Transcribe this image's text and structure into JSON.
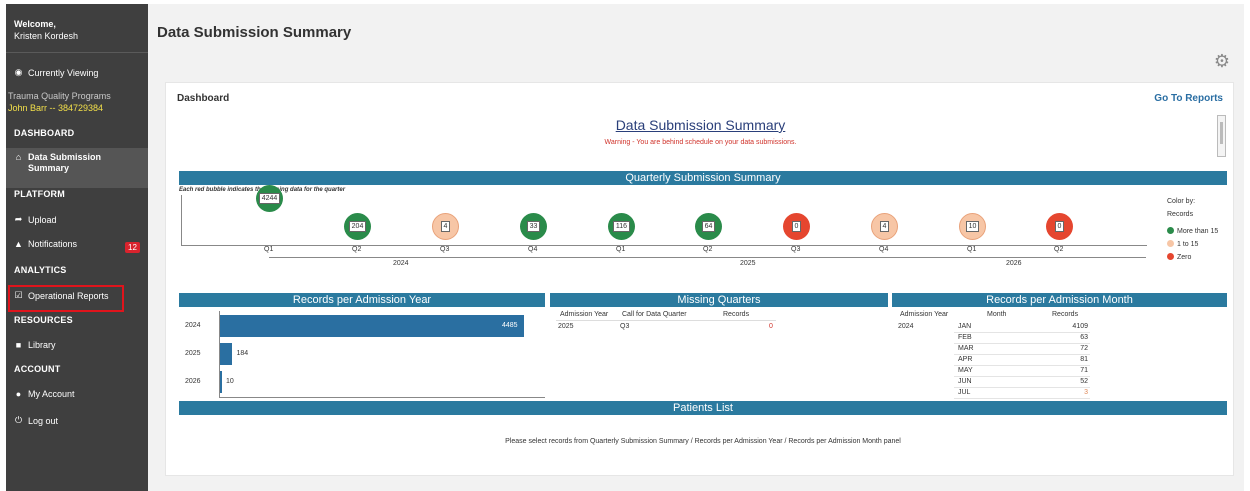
{
  "sidebar": {
    "welcome_title": "Welcome,",
    "user_name": "Kristen Kordesh",
    "currently_viewing": "Currently Viewing",
    "program_name": "Trauma Quality Programs",
    "program_user": "John Barr -- 384729384",
    "sections": {
      "dashboard": "DASHBOARD",
      "platform": "PLATFORM",
      "analytics": "ANALYTICS",
      "resources": "RESOURCES",
      "account": "ACCOUNT"
    },
    "items": {
      "data_submission_summary": "Data Submission Summary",
      "upload": "Upload",
      "notifications": "Notifications",
      "notifications_badge": "12",
      "operational_reports": "Operational Reports",
      "library": "Library",
      "my_account": "My Account",
      "log_out": "Log out"
    },
    "icons": {
      "eye": "eye-icon",
      "home": "home-icon",
      "upload": "upload-icon",
      "bell": "bell-icon",
      "report": "checkbox-report-icon",
      "book": "book-icon",
      "user": "user-icon",
      "power": "power-icon"
    }
  },
  "main": {
    "page_title": "Data Submission Summary",
    "dashboard_label": "Dashboard",
    "go_to_reports": "Go To Reports",
    "report_title": "Data Submission Summary",
    "warning": "Warning - You are behind schedule on your data submissions."
  },
  "quarterly": {
    "title": "Quarterly Submission Summary",
    "note": "Each red bubble indicates the missing data for the quarter",
    "bubbles": [
      {
        "label": "4244",
        "color": "green"
      },
      {
        "label": "204",
        "color": "green"
      },
      {
        "label": "4",
        "color": "orange"
      },
      {
        "label": "33",
        "color": "green"
      },
      {
        "label": "116",
        "color": "green"
      },
      {
        "label": "64",
        "color": "green"
      },
      {
        "label": "0",
        "color": "red"
      },
      {
        "label": "4",
        "color": "orange"
      },
      {
        "label": "10",
        "color": "orange"
      },
      {
        "label": "0",
        "color": "red"
      }
    ],
    "quarters": [
      "Q1",
      "Q2",
      "Q3",
      "Q4",
      "Q1",
      "Q2",
      "Q3",
      "Q4",
      "Q1",
      "Q2"
    ],
    "years": [
      "2024",
      "2025",
      "2026"
    ],
    "legend": {
      "title_line1": "Color by:",
      "title_line2": "Records",
      "items": [
        {
          "label": "More than 15",
          "color": "#2a8b4a"
        },
        {
          "label": "1 to 15",
          "color": "#f7c6a6"
        },
        {
          "label": "Zero",
          "color": "#e5462f"
        }
      ]
    }
  },
  "records_per_year": {
    "title": "Records per Admission Year"
  },
  "chart_data": {
    "type": "bar",
    "orientation": "horizontal",
    "title": "Records per Admission Year",
    "categories": [
      "2024",
      "2025",
      "2026"
    ],
    "values": [
      4485,
      184,
      10
    ],
    "xlim": [
      0,
      4485
    ]
  },
  "missing_quarters": {
    "title": "Missing Quarters",
    "headers": [
      "Admission Year",
      "Call for Data Quarter",
      "Records"
    ],
    "rows": [
      {
        "year": "2025",
        "quarter": "Q3",
        "records": "0"
      }
    ]
  },
  "records_per_month": {
    "title": "Records per Admission Month",
    "headers": [
      "Admission Year",
      "Month",
      "Records"
    ],
    "year": "2024",
    "rows": [
      {
        "month": "JAN",
        "records": "4109"
      },
      {
        "month": "FEB",
        "records": "63"
      },
      {
        "month": "MAR",
        "records": "72"
      },
      {
        "month": "APR",
        "records": "81"
      },
      {
        "month": "MAY",
        "records": "71"
      },
      {
        "month": "JUN",
        "records": "52"
      },
      {
        "month": "JUL",
        "records": "3"
      }
    ]
  },
  "patients": {
    "title": "Patients List",
    "message": "Please select records from Quarterly Submission Summary / Records per Admission Year / Records per Admission Month panel"
  },
  "colors": {
    "band": "#2b7a9f",
    "bar": "#2a6fa1",
    "highlight": "#e0141c",
    "warning": "#d0332b"
  }
}
